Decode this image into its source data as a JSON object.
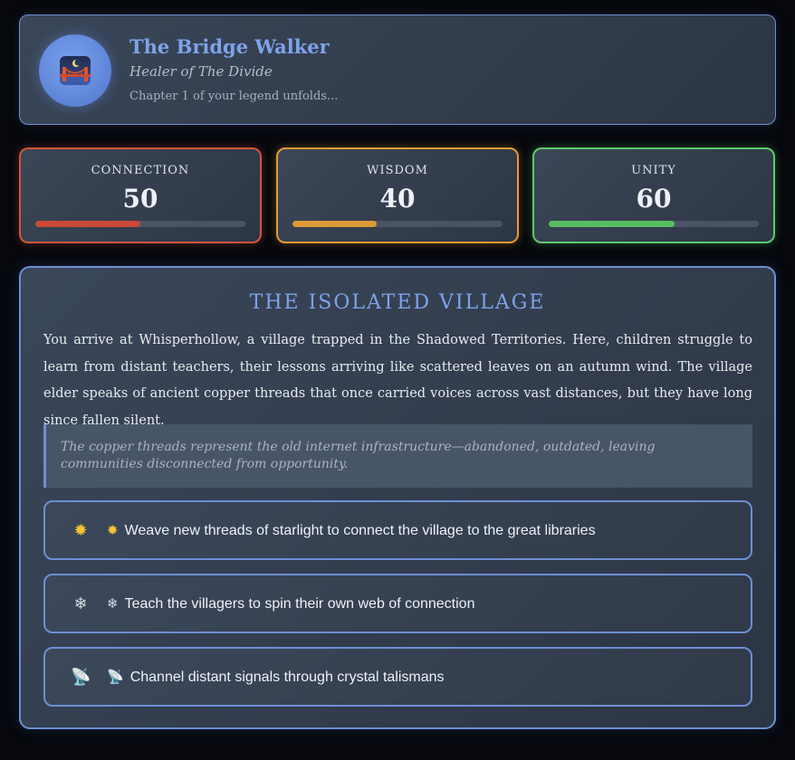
{
  "header": {
    "title": "The Bridge Walker",
    "subtitle": "Healer of The Divide",
    "chapter": "Chapter 1 of your legend unfolds...",
    "avatar_icon": "bridge-at-night-icon"
  },
  "stats": [
    {
      "label": "CONNECTION",
      "value": "50",
      "percent": 50,
      "color": "#c94a37"
    },
    {
      "label": "WISDOM",
      "value": "40",
      "percent": 40,
      "color": "#dc9a38"
    },
    {
      "label": "UNITY",
      "value": "60",
      "percent": 60,
      "color": "#58bd62"
    }
  ],
  "scene": {
    "title": "THE ISOLATED VILLAGE",
    "text": "You arrive at Whisperhollow, a village trapped in the Shadowed Territories. Here, children struggle to learn from distant teachers, their lessons arriving like scattered leaves on an autumn wind. The village elder speaks of ancient copper threads that once carried voices across vast distances, but they have long since fallen silent.",
    "note": "The copper threads represent the old internet infrastructure—abandoned, outdated, leaving communities disconnected from opportunity.",
    "choices": [
      {
        "icon": "sun-icon",
        "glyph": "✹",
        "label": "Weave new threads of starlight to connect the village to the great libraries"
      },
      {
        "icon": "web-icon",
        "glyph": "❄",
        "label": "Teach the villagers to spin their own web of connection"
      },
      {
        "icon": "satellite-antenna-icon",
        "glyph": "📡",
        "label": "Channel distant signals through crystal talismans"
      }
    ]
  }
}
